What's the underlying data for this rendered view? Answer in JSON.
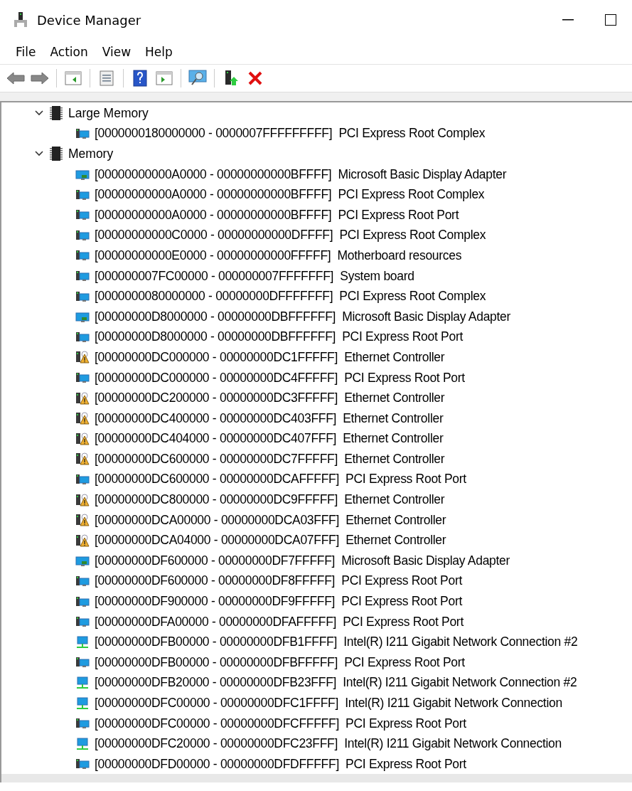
{
  "window": {
    "title": "Device Manager"
  },
  "menu": [
    "File",
    "Action",
    "View",
    "Help"
  ],
  "toolbar": [
    {
      "kind": "back"
    },
    {
      "kind": "forward"
    },
    {
      "kind": "sep"
    },
    {
      "kind": "tree-pane"
    },
    {
      "kind": "sep"
    },
    {
      "kind": "properties"
    },
    {
      "kind": "sep"
    },
    {
      "kind": "help"
    },
    {
      "kind": "action-pane"
    },
    {
      "kind": "sep"
    },
    {
      "kind": "scan"
    },
    {
      "kind": "sep"
    },
    {
      "kind": "update"
    },
    {
      "kind": "uninstall"
    }
  ],
  "tree": [
    {
      "label": "Large Memory",
      "expanded": true,
      "children": [
        {
          "kind": "computer",
          "range": "[0000000180000000 - 0000007FFFFFFFFF]",
          "device": "PCI Express Root Complex"
        }
      ]
    },
    {
      "label": "Memory",
      "expanded": true,
      "children": [
        {
          "kind": "display",
          "range": "[00000000000A0000 - 00000000000BFFFF]",
          "device": "Microsoft Basic Display Adapter"
        },
        {
          "kind": "computer",
          "range": "[00000000000A0000 - 00000000000BFFFF]",
          "device": "PCI Express Root Complex"
        },
        {
          "kind": "computer",
          "range": "[00000000000A0000 - 00000000000BFFFF]",
          "device": "PCI Express Root Port"
        },
        {
          "kind": "computer",
          "range": "[00000000000C0000 - 00000000000DFFFF]",
          "device": "PCI Express Root Complex"
        },
        {
          "kind": "computer",
          "range": "[00000000000E0000 - 00000000000FFFFF]",
          "device": "Motherboard resources"
        },
        {
          "kind": "computer",
          "range": "[000000007FC00000 - 000000007FFFFFFF]",
          "device": "System board"
        },
        {
          "kind": "computer",
          "range": "[0000000080000000 - 00000000DFFFFFFF]",
          "device": "PCI Express Root Complex"
        },
        {
          "kind": "display",
          "range": "[00000000D8000000 - 00000000DBFFFFFF]",
          "device": "Microsoft Basic Display Adapter"
        },
        {
          "kind": "computer",
          "range": "[00000000D8000000 - 00000000DBFFFFFF]",
          "device": "PCI Express Root Port"
        },
        {
          "kind": "warning",
          "range": "[00000000DC000000 - 00000000DC1FFFFF]",
          "device": "Ethernet Controller"
        },
        {
          "kind": "computer",
          "range": "[00000000DC000000 - 00000000DC4FFFFF]",
          "device": "PCI Express Root Port"
        },
        {
          "kind": "warning",
          "range": "[00000000DC200000 - 00000000DC3FFFFF]",
          "device": "Ethernet Controller"
        },
        {
          "kind": "warning",
          "range": "[00000000DC400000 - 00000000DC403FFF]",
          "device": "Ethernet Controller"
        },
        {
          "kind": "warning",
          "range": "[00000000DC404000 - 00000000DC407FFF]",
          "device": "Ethernet Controller"
        },
        {
          "kind": "warning",
          "range": "[00000000DC600000 - 00000000DC7FFFFF]",
          "device": "Ethernet Controller"
        },
        {
          "kind": "computer",
          "range": "[00000000DC600000 - 00000000DCAFFFFF]",
          "device": "PCI Express Root Port"
        },
        {
          "kind": "warning",
          "range": "[00000000DC800000 - 00000000DC9FFFFF]",
          "device": "Ethernet Controller"
        },
        {
          "kind": "warning",
          "range": "[00000000DCA00000 - 00000000DCA03FFF]",
          "device": "Ethernet Controller"
        },
        {
          "kind": "warning",
          "range": "[00000000DCA04000 - 00000000DCA07FFF]",
          "device": "Ethernet Controller"
        },
        {
          "kind": "display",
          "range": "[00000000DF600000 - 00000000DF7FFFFF]",
          "device": "Microsoft Basic Display Adapter"
        },
        {
          "kind": "computer",
          "range": "[00000000DF600000 - 00000000DF8FFFFF]",
          "device": "PCI Express Root Port"
        },
        {
          "kind": "computer",
          "range": "[00000000DF900000 - 00000000DF9FFFFF]",
          "device": "PCI Express Root Port"
        },
        {
          "kind": "computer",
          "range": "[00000000DFA00000 - 00000000DFAFFFFF]",
          "device": "PCI Express Root Port"
        },
        {
          "kind": "network",
          "range": "[00000000DFB00000 - 00000000DFB1FFFF]",
          "device": "Intel(R) I211 Gigabit Network Connection #2"
        },
        {
          "kind": "computer",
          "range": "[00000000DFB00000 - 00000000DFBFFFFF]",
          "device": "PCI Express Root Port"
        },
        {
          "kind": "network",
          "range": "[00000000DFB20000 - 00000000DFB23FFF]",
          "device": "Intel(R) I211 Gigabit Network Connection #2"
        },
        {
          "kind": "network",
          "range": "[00000000DFC00000 - 00000000DFC1FFFF]",
          "device": "Intel(R) I211 Gigabit Network Connection"
        },
        {
          "kind": "computer",
          "range": "[00000000DFC00000 - 00000000DFCFFFFF]",
          "device": "PCI Express Root Port"
        },
        {
          "kind": "network",
          "range": "[00000000DFC20000 - 00000000DFC23FFF]",
          "device": "Intel(R) I211 Gigabit Network Connection"
        },
        {
          "kind": "computer",
          "range": "[00000000DFD00000 - 00000000DFDFFFFF]",
          "device": "PCI Express Root Port"
        }
      ]
    }
  ]
}
